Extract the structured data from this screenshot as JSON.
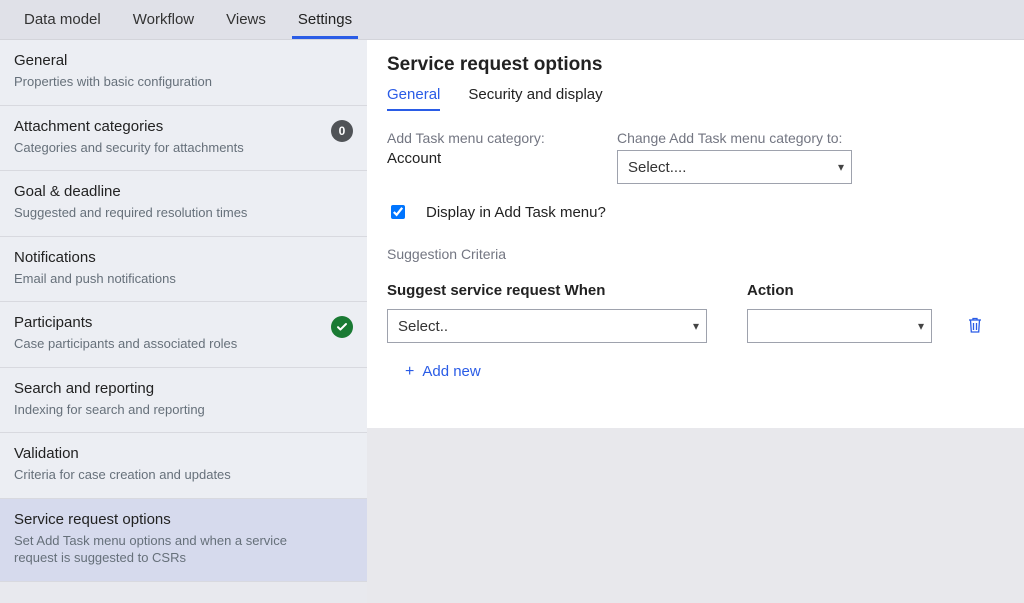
{
  "topTabs": [
    {
      "label": "Data model",
      "active": false
    },
    {
      "label": "Workflow",
      "active": false
    },
    {
      "label": "Views",
      "active": false
    },
    {
      "label": "Settings",
      "active": true
    }
  ],
  "sidebar": [
    {
      "title": "General",
      "sub": "Properties with basic configuration",
      "badge": null,
      "check": false,
      "selected": false
    },
    {
      "title": "Attachment categories",
      "sub": "Categories and security for attachments",
      "badge": "0",
      "check": false,
      "selected": false
    },
    {
      "title": "Goal & deadline",
      "sub": "Suggested and required resolution times",
      "badge": null,
      "check": false,
      "selected": false
    },
    {
      "title": "Notifications",
      "sub": "Email and push notifications",
      "badge": null,
      "check": false,
      "selected": false
    },
    {
      "title": "Participants",
      "sub": "Case participants and associated roles",
      "badge": null,
      "check": true,
      "selected": false
    },
    {
      "title": "Search and reporting",
      "sub": "Indexing for search and reporting",
      "badge": null,
      "check": false,
      "selected": false
    },
    {
      "title": "Validation",
      "sub": "Criteria for case creation and updates",
      "badge": null,
      "check": false,
      "selected": false
    },
    {
      "title": "Service request options",
      "sub": "Set Add Task menu options and when a service request is suggested to CSRs",
      "badge": null,
      "check": false,
      "selected": true
    }
  ],
  "panel": {
    "title": "Service request options",
    "subtabs": [
      {
        "label": "General",
        "active": true
      },
      {
        "label": "Security and display",
        "active": false
      }
    ],
    "currentCategoryLabel": "Add Task menu category:",
    "currentCategoryValue": "Account",
    "changeCategoryLabel": "Change Add Task menu category to:",
    "changeCategoryPlaceholder": "Select....",
    "displayCheckboxLabel": "Display in Add Task menu?",
    "displayCheckboxChecked": true,
    "suggestionCriteriaLabel": "Suggestion Criteria",
    "whenHeader": "Suggest service request When",
    "actionHeader": "Action",
    "whenPlaceholder": "Select..",
    "actionPlaceholder": "",
    "addNewLabel": "Add new"
  }
}
